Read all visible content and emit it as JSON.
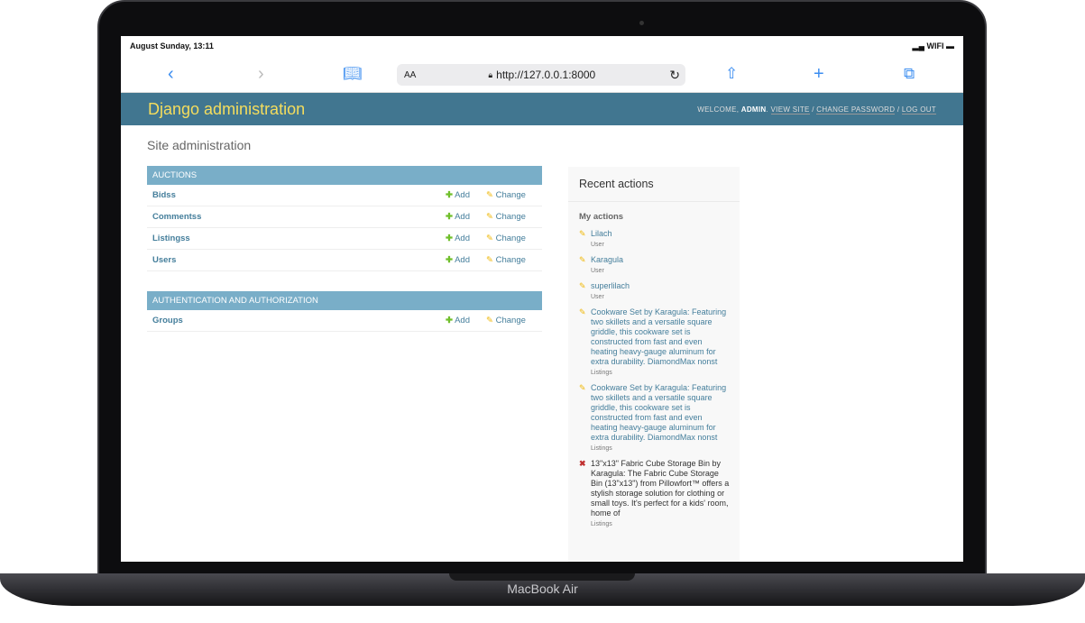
{
  "device": {
    "brand": "MacBook Air"
  },
  "status_bar": {
    "datetime": "August Sunday, 13:11",
    "wifi": "WIFI"
  },
  "browser": {
    "text_size": "AA",
    "url": "http://127.0.0.1:8000"
  },
  "header": {
    "title": "Django administration",
    "welcome": "WELCOME,",
    "user": "ADMIN",
    "view_site": "VIEW SITE",
    "change_password": "CHANGE PASSWORD",
    "log_out": "LOG OUT"
  },
  "page_title": "Site administration",
  "modules": [
    {
      "caption": "AUCTIONS",
      "rows": [
        {
          "name": "Bidss"
        },
        {
          "name": "Commentss"
        },
        {
          "name": "Listingss"
        },
        {
          "name": "Users"
        }
      ]
    },
    {
      "caption": "AUTHENTICATION AND AUTHORIZATION",
      "rows": [
        {
          "name": "Groups"
        }
      ]
    }
  ],
  "labels": {
    "add": "Add",
    "change": "Change"
  },
  "recent": {
    "title": "Recent actions",
    "subtitle": "My actions",
    "items": [
      {
        "type": "change",
        "text": "Lilach",
        "model": "User"
      },
      {
        "type": "change",
        "text": "Karagula",
        "model": "User"
      },
      {
        "type": "change",
        "text": "superlilach",
        "model": "User"
      },
      {
        "type": "change",
        "text": "Cookware Set by Karagula: Featuring two skillets and a versatile square griddle, this cookware set is constructed from fast and even heating heavy-gauge aluminum for extra durability. DiamondMax nonst",
        "model": "Listings"
      },
      {
        "type": "change",
        "text": "Cookware Set by Karagula: Featuring two skillets and a versatile square griddle, this cookware set is constructed from fast and even heating heavy-gauge aluminum for extra durability. DiamondMax nonst",
        "model": "Listings"
      },
      {
        "type": "delete",
        "text": "13\"x13\" Fabric Cube Storage Bin by Karagula: The Fabric Cube Storage Bin (13\"x13\") from Pillowfort™ offers a stylish storage solution for clothing or small toys. It's perfect for a kids' room, home of",
        "model": "Listings"
      }
    ]
  }
}
